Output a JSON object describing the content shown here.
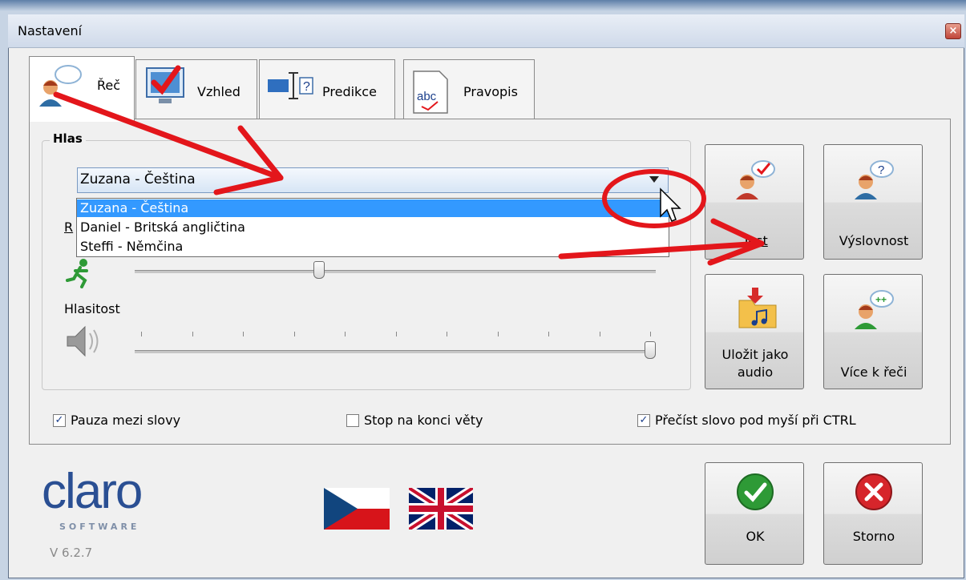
{
  "window": {
    "title": "Nastavení",
    "close_glyph": "×"
  },
  "tabs": [
    {
      "label": "Řeč",
      "icon": "speaker-person-icon"
    },
    {
      "label": "Vzhled",
      "icon": "monitor-check-icon"
    },
    {
      "label": "Predikce",
      "icon": "text-cursor-icon"
    },
    {
      "label": "Pravopis",
      "icon": "abc-spell-icon"
    }
  ],
  "voice_group": {
    "title": "Hlas",
    "selected_voice": "Zuzana - Čeština",
    "options": [
      "Zuzana - Čeština",
      "Daniel - Britská angličtina",
      "Steffi - Němčina"
    ],
    "rate_label_partial": "R",
    "rate_value": 0.35,
    "volume_label": "Hlasitost",
    "volume_value": 1.0
  },
  "buttons": {
    "test": "Test",
    "pronunciation": "Výslovnost",
    "save_audio_line1": "Uložit jako",
    "save_audio_line2": "audio",
    "more_speech": "Více k řeči",
    "ok": "OK",
    "cancel": "Storno"
  },
  "checkboxes": [
    {
      "label": "Pauza mezi slovy",
      "checked": true
    },
    {
      "label": "Stop na konci věty",
      "checked": false
    },
    {
      "label": "Přečíst slovo pod myší při CTRL",
      "checked": true
    }
  ],
  "branding": {
    "logo": "claro",
    "sub": "SOFTWARE",
    "version": "V 6.2.7"
  },
  "flags": [
    "czech-flag-icon",
    "uk-flag-icon"
  ],
  "colors": {
    "accent": "#3399ff",
    "annotation": "#e3161b",
    "ok_green": "#2e9a36",
    "cancel_red": "#d6252b"
  }
}
